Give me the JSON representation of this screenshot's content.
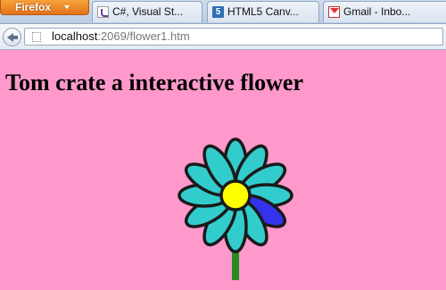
{
  "browser": {
    "app_button_label": "Firefox",
    "tabs": [
      {
        "label": "C#, Visual St...",
        "icon": "visual-studio-icon"
      },
      {
        "label": "HTML5 Canv...",
        "icon": "html5-icon"
      },
      {
        "label": "Gmail - Inbo...",
        "icon": "gmail-icon"
      }
    ],
    "close_glyph": "×",
    "url": {
      "host": "localhost",
      "rest": ":2069/flower1.htm"
    }
  },
  "page": {
    "heading": "Tom crate a interactive flower",
    "background_color": "#ff99cc",
    "flower": {
      "petal_color": "#33cccc",
      "highlighted_petal_color": "#3333ee",
      "center_color": "#ffff00",
      "stem_color": "#228b22",
      "outline_color": "#1a1a1a",
      "petal_count": 12,
      "highlighted_petal_index": 4
    }
  }
}
